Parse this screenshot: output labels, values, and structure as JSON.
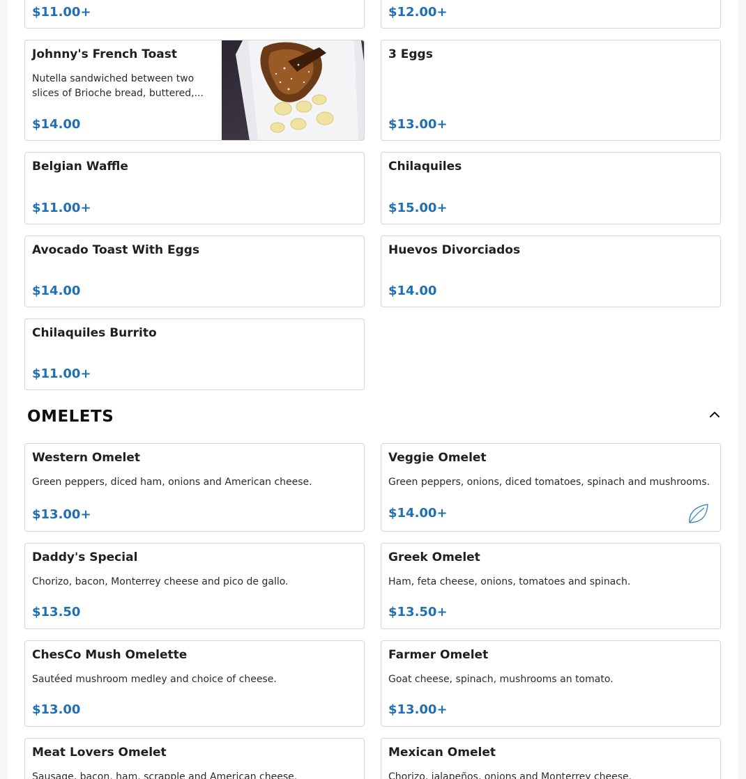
{
  "sections": [
    {
      "id": "breakfast",
      "items": [
        {
          "name": "",
          "price": "$11.00+"
        },
        {
          "name": "",
          "price": "$12.00+"
        },
        {
          "name": "Johnny's French Toast",
          "description": "Nutella sandwiched between two slices of Brioche bread, buttered,...",
          "price": "$14.00",
          "image": "french-toast-photo"
        },
        {
          "name": "3 Eggs",
          "price": "$13.00+"
        },
        {
          "name": "Belgian Waffle",
          "price": "$11.00+"
        },
        {
          "name": "Chilaquiles",
          "price": "$15.00+"
        },
        {
          "name": "Avocado Toast With Eggs",
          "price": "$14.00"
        },
        {
          "name": "Huevos Divorciados",
          "price": "$14.00"
        },
        {
          "name": "Chilaquiles Burrito",
          "price": "$11.00+"
        }
      ]
    },
    {
      "id": "omelets",
      "title": "OMELETS",
      "toggle_icon": "chevron-up-icon",
      "items": [
        {
          "name": "Western Omelet",
          "description": "Green peppers, diced ham, onions and American cheese.",
          "price": "$13.00+"
        },
        {
          "name": "Veggie Omelet",
          "description": "Green peppers, onions, diced tomatoes, spinach and mushrooms.",
          "price": "$14.00+",
          "badge_icon": "vegetarian-leaf-icon"
        },
        {
          "name": "Daddy's Special",
          "description": "Chorizo, bacon, Monterrey cheese and pico de gallo.",
          "price": "$13.50"
        },
        {
          "name": "Greek Omelet",
          "description": "Ham, feta cheese, onions, tomatoes and spinach.",
          "price": "$13.50+"
        },
        {
          "name": "ChesCo Mush Omelette",
          "description": "Sautéed mushroom medley and choice of cheese.",
          "price": "$13.00"
        },
        {
          "name": "Farmer Omelet",
          "description": "Goat cheese, spinach, mushrooms an tomato.",
          "price": "$13.00+"
        },
        {
          "name": "Meat Lovers Omelet",
          "description": "Sausage, bacon, ham, scrapple and American cheese.",
          "price": ""
        },
        {
          "name": "Mexican Omelet",
          "description": "Chorizo, jalapeños, onions and Monterrey cheese.",
          "price": ""
        }
      ]
    }
  ],
  "colors": {
    "price": "#1f6fb5",
    "border": "#d6d6d6",
    "leaf": "#2a7fb8"
  }
}
